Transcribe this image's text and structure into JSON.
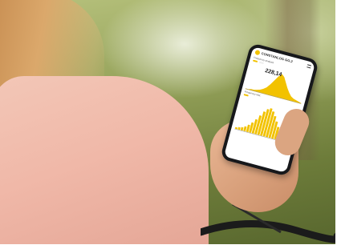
{
  "app": {
    "title": "CONSTANLOG GO.2",
    "section1_label": "Frequency analysis",
    "value": "228,14",
    "section2_label": "Frequency Hist."
  },
  "icons": {
    "logo": "logo-circle-icon",
    "menu": "hamburger-menu-icon"
  },
  "colors": {
    "accent": "#f2c200",
    "phone_body": "#17181b"
  },
  "chart_data": [
    {
      "type": "area",
      "values": [
        1,
        1,
        2,
        2,
        3,
        4,
        6,
        9,
        14,
        20,
        26,
        30,
        27,
        21,
        15,
        10,
        6,
        4,
        3,
        2,
        1
      ]
    },
    {
      "type": "bar",
      "values": [
        2,
        3,
        4,
        6,
        9,
        13,
        18,
        24,
        30,
        34,
        36,
        33,
        28,
        22,
        16,
        11,
        7,
        5,
        3,
        2
      ]
    }
  ]
}
